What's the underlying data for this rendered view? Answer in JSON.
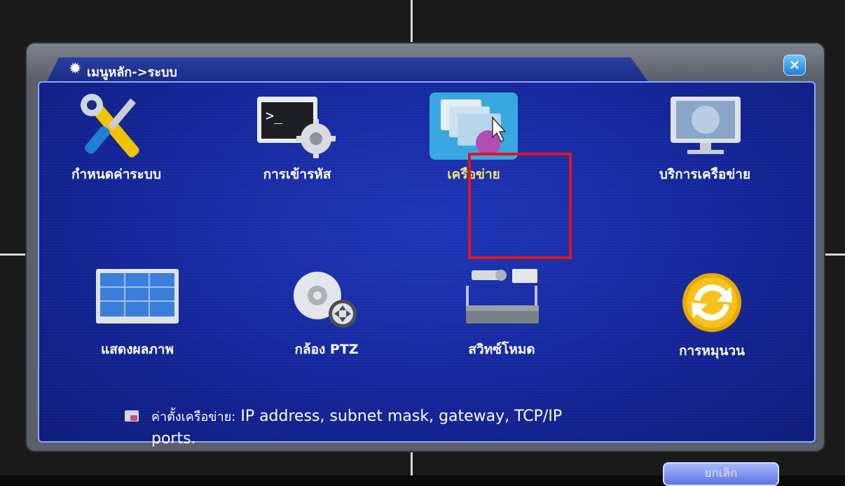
{
  "dialog": {
    "title": "เมนูหลัก->ระบบ",
    "close_label": "×",
    "items": [
      {
        "label": "กำหนดค่าระบบ",
        "icon": "tools-icon"
      },
      {
        "label": "การเข้ารหัส",
        "icon": "terminal-gear-icon"
      },
      {
        "label": "เครือข่าย",
        "icon": "network-icon",
        "selected": true
      },
      {
        "label": "บริการเครือข่าย",
        "icon": "globe-monitor-icon"
      },
      {
        "label": "แสดงผลภาพ",
        "icon": "display-grid-icon"
      },
      {
        "label": "กล้อง PTZ",
        "icon": "ptz-camera-icon"
      },
      {
        "label": "สวิทซ์โหมด",
        "icon": "switch-mode-icon"
      },
      {
        "label": "การหมุนวน",
        "icon": "rotate-icon"
      }
    ],
    "description": {
      "prefix": "ค่าตั้งเครือข่าย:",
      "line1": "IP address, subnet mask, gateway, TCP/IP",
      "line2": "ports."
    },
    "cancel_label": "ยกเลิก"
  },
  "colors": {
    "panel_blue": "#13259a",
    "selected_label": "#f3e36a",
    "selection_border": "#e2141c"
  }
}
